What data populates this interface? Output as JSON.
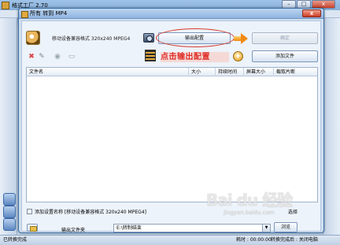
{
  "app": {
    "title": "格式工厂 2.70",
    "controls": {
      "min": "–",
      "max": "□",
      "close": "x"
    }
  },
  "background": {
    "status_left": "已转换完成",
    "status_right_time": "耗时 : 00:00:00",
    "status_right_action": "转换完成后 : 关闭电脑"
  },
  "dialog": {
    "title": "所有 转到 MP4",
    "close_label": "x",
    "format_text": "移动设备兼容格式 320x240 MPEG4",
    "output_config_label": "输出配置",
    "ok_label": "确定",
    "add_file_label": "添加文件",
    "hint_text": "点击输出配置",
    "table": {
      "columns": [
        "文件名",
        "大小",
        "持续时间",
        "屏幕大小",
        "截取片断"
      ]
    },
    "add_setting_name_label": "添加设置名称 [移动设备兼容格式 320x240 MPEG4]",
    "output_folder_label": "输出文件夹",
    "output_folder_value": "E:\\转制结束",
    "browse_label": "浏览",
    "right_label": "选择"
  },
  "watermark": {
    "logo": "Bai du 经验",
    "sub": "jingyan.baidu.com"
  },
  "colors": {
    "hint_text": "#e0302a",
    "hint_bg": "#f4d9d6",
    "highlight_ellipse": "#d83a2e",
    "dialog_title_bg": "#8fb3df"
  }
}
